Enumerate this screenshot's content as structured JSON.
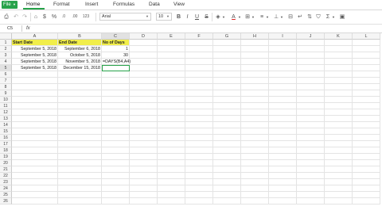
{
  "menu": {
    "file": "File",
    "tabs": [
      "Home",
      "Format",
      "Insert",
      "Formulas",
      "Data",
      "View"
    ],
    "active_tab": "Home"
  },
  "toolbar": {
    "font": "Arial",
    "font_size": "10",
    "bold": "B",
    "italic": "I",
    "underline": "U",
    "strike": "S",
    "font_color": "A",
    "sum": "Σ"
  },
  "formula_bar": {
    "cell_ref": "C5",
    "fx": "fx",
    "content": ""
  },
  "grid": {
    "columns": [
      "A",
      "B",
      "C",
      "D",
      "E",
      "F",
      "G",
      "H",
      "I",
      "J",
      "K",
      "L"
    ],
    "rows": [
      "1",
      "2",
      "3",
      "4",
      "5",
      "6",
      "7",
      "8",
      "9",
      "10",
      "11",
      "12",
      "13",
      "14",
      "15",
      "16",
      "17",
      "18",
      "19",
      "20",
      "21",
      "22",
      "23",
      "24",
      "25",
      "26"
    ],
    "cells": {
      "A1": "Start Date",
      "B1": "End Date",
      "C1": "No of Days",
      "A2": "September 5, 2018",
      "B2": "September 6, 2018",
      "C2": "1",
      "A3": "September 5, 2018",
      "B3": "October 5, 2018",
      "C3": "30",
      "A4": "September 5, 2018",
      "B4": "November 5, 2018",
      "C4": "=DAYS(B4,A4)",
      "A5": "September 5, 2018",
      "B5": "December 15, 2018",
      "C5": ""
    }
  },
  "colors": {
    "accent": "#27a24a",
    "header_fill": "#f1ee4a"
  }
}
